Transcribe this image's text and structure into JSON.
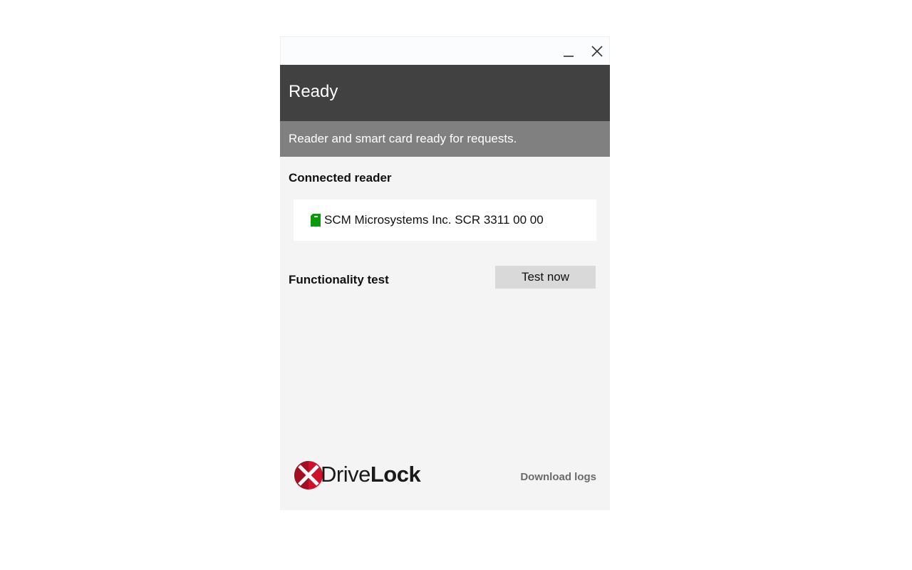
{
  "window": {
    "minimize_icon": "minimize-icon",
    "close_icon": "close-icon"
  },
  "header": {
    "title": "Ready",
    "subtitle": "Reader and smart card ready for requests.",
    "dark_color": "#414141",
    "sub_color": "#808080"
  },
  "reader_section": {
    "label": "Connected reader",
    "reader_name": "SCM Microsystems Inc. SCR 3311 00 00",
    "reader_icon": "smart-card-icon",
    "icon_color": "#0a9b0a"
  },
  "test_section": {
    "label": "Functionality test",
    "button_label": "Test now"
  },
  "footer": {
    "logo_part1": "Drive",
    "logo_part2": "Lock",
    "logo_icon": "drivelock-x-icon",
    "logo_color": "#d0112b",
    "download_link": "Download logs"
  }
}
